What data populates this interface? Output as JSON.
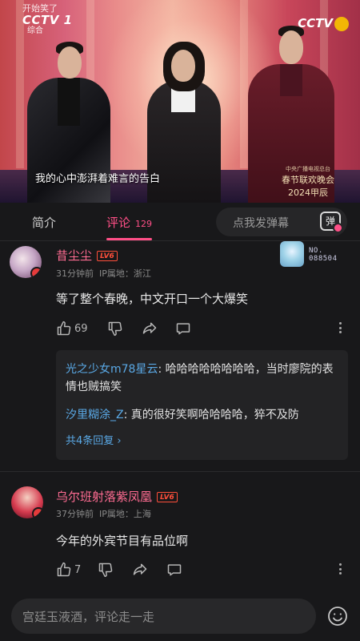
{
  "video": {
    "channel_top": "开始笑了",
    "channel_logo": "CCTV 1",
    "channel_sub": "综合",
    "right_logo": "CCTV",
    "subtitle": "我的心中澎湃着难言的告白",
    "gala_line1": "中央广播电视总台",
    "gala_line2": "春节联欢晚会",
    "gala_line3": "2024甲辰"
  },
  "tabs": {
    "intro": "简介",
    "comments": "评论",
    "comments_count": "129",
    "danmu_placeholder": "点我发弹幕",
    "danmu_button": "弹"
  },
  "comments": [
    {
      "user": "昔尘尘",
      "level": "LV6",
      "time": "31分钟前",
      "location": "IP属地：浙江",
      "text": "等了整个春晚，中文开口一个大爆笑",
      "likes": "69",
      "fan_badge": {
        "label": "NO.",
        "number": "088504"
      },
      "replies": [
        {
          "user": "光之少女m78星云",
          "text": "哈哈哈哈哈哈哈哈，当时廖院的表情也贼搞笑"
        },
        {
          "user": "汐里糊涂_Z",
          "text": "真的很好笑啊哈哈哈哈，猝不及防"
        }
      ],
      "reply_more": "共4条回复 ›"
    },
    {
      "user": "乌尔班射落紫凤凰",
      "level": "LV6",
      "time": "37分钟前",
      "location": "IP属地：上海",
      "text": "今年的外宾节目有品位啊",
      "likes": "7"
    }
  ],
  "input": {
    "placeholder": "宫廷玉液酒，评论走一走"
  },
  "colors": {
    "accent": "#ff4f87",
    "username": "#ff6c92",
    "reply_user": "#5aa9e6",
    "background": "#18181a"
  },
  "icons": [
    "like-icon",
    "dislike-icon",
    "share-icon",
    "comment-icon",
    "more-icon",
    "danmu-icon",
    "emoji-icon"
  ]
}
